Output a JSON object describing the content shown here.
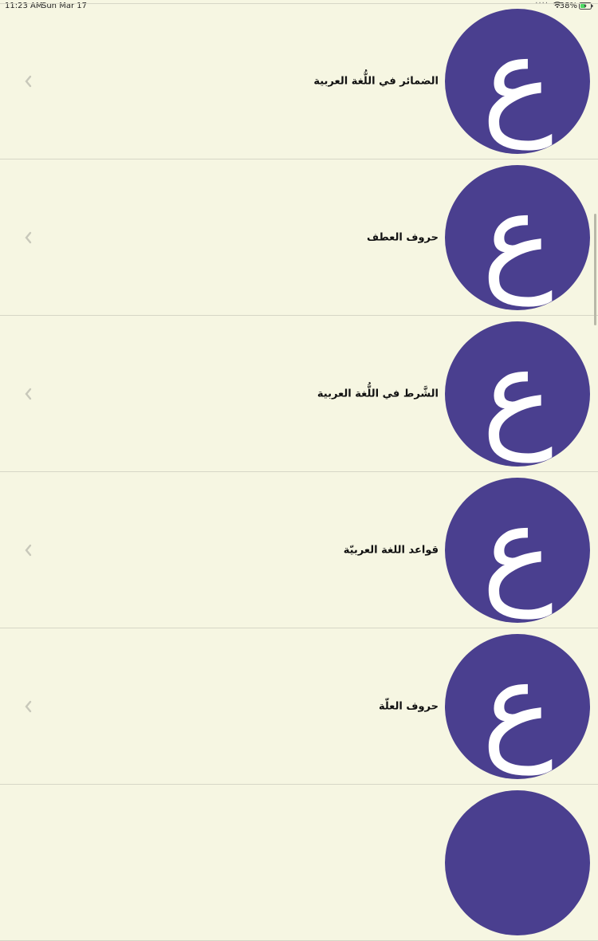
{
  "status_bar": {
    "time": "11:23 AM",
    "date": "Sun Mar 17",
    "battery_percent": "38%"
  },
  "items": [
    {
      "title": "الضمائر في اللُّغة العربية"
    },
    {
      "title": "حروف العطف"
    },
    {
      "title": "الشَّرط في اللُّغة العربية"
    },
    {
      "title": "قواعد اللغة العربيّة"
    },
    {
      "title": "حروف العلّة"
    },
    {
      "title": ""
    }
  ],
  "thumbnail": {
    "glyph": "ع",
    "background_color": "#4a3f8f",
    "glyph_color": "#ffffff"
  },
  "colors": {
    "background": "#f6f6e2",
    "divider": "#d6d6c6",
    "chevron": "#c8c8ba"
  }
}
